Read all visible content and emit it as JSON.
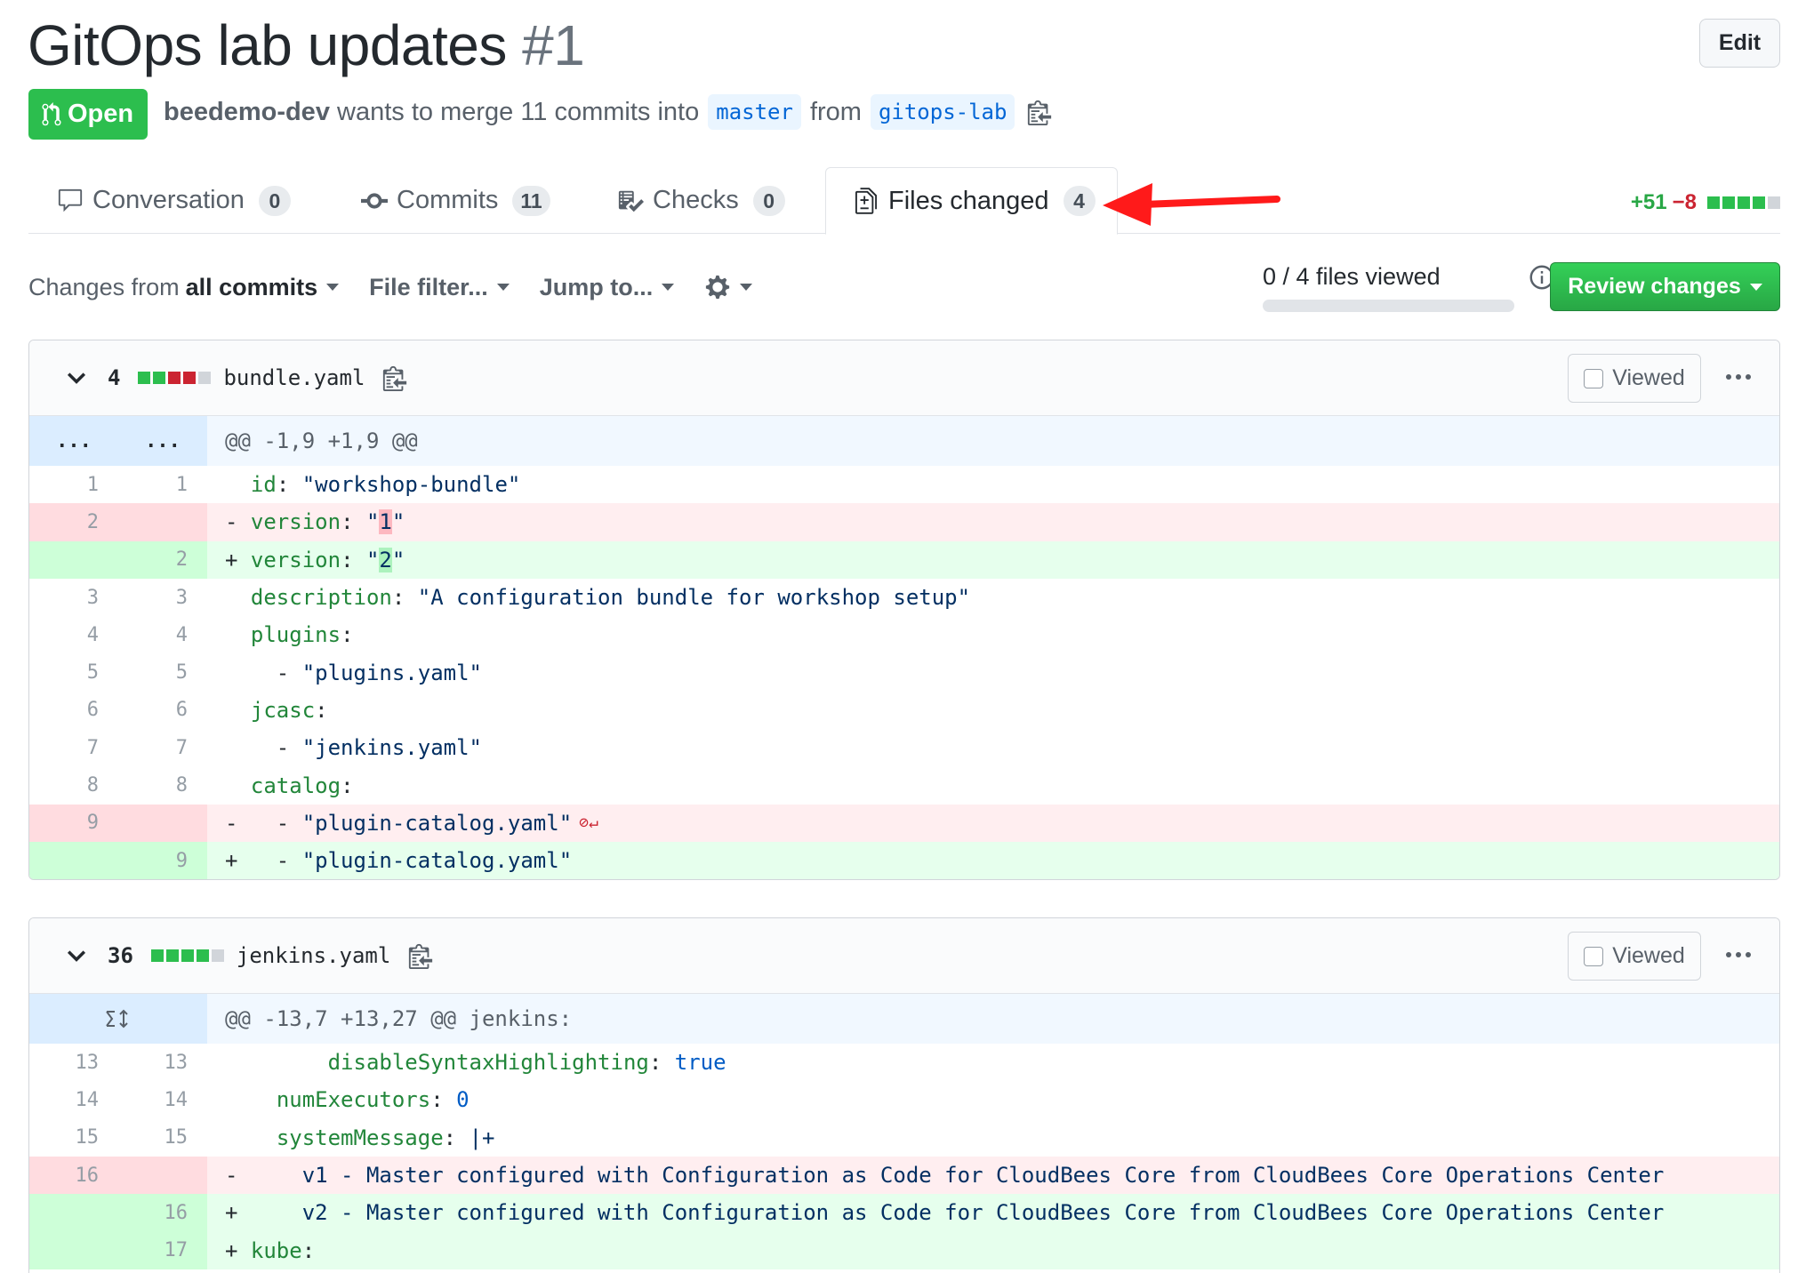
{
  "pr": {
    "title": "GitOps lab updates",
    "number": "#1",
    "edit_label": "Edit",
    "state": "Open",
    "author": "beedemo-dev",
    "merge_text": "wants to merge 11 commits into",
    "base_branch": "master",
    "from_text": "from",
    "head_branch": "gitops-lab"
  },
  "tabs": [
    {
      "label": "Conversation",
      "count": "0",
      "icon": "comment-icon"
    },
    {
      "label": "Commits",
      "count": "11",
      "icon": "commit-icon"
    },
    {
      "label": "Checks",
      "count": "0",
      "icon": "checklist-icon"
    },
    {
      "label": "Files changed",
      "count": "4",
      "icon": "file-diff-icon",
      "selected": true
    }
  ],
  "diffstat": {
    "additions": "+51",
    "deletions": "−8"
  },
  "toolbar": {
    "changes_prefix": "Changes from",
    "changes_value": "all commits",
    "file_filter": "File filter...",
    "jump_to": "Jump to...",
    "files_viewed": "0 / 4 files viewed",
    "review_button": "Review changes"
  },
  "files": [
    {
      "count": "4",
      "name": "bundle.yaml",
      "viewed_label": "Viewed",
      "hunk_left": "...",
      "hunk_right": "...",
      "hunk": "@@ -1,9 +1,9 @@"
    },
    {
      "count": "36",
      "name": "jenkins.yaml",
      "viewed_label": "Viewed",
      "hunk": "@@ -13,7 +13,27 @@ jenkins:"
    }
  ],
  "bundle_lines": [
    {
      "type": "ctx",
      "old": "1",
      "new": "1",
      "sign": " ",
      "indent": "",
      "key": "id",
      "sep": ": ",
      "val": "\"workshop-bundle\""
    },
    {
      "type": "rm",
      "old": "2",
      "new": "",
      "sign": "-",
      "indent": "",
      "key": "version",
      "sep": ": ",
      "val_pre": "\"",
      "val_hl": "1",
      "val_post": "\""
    },
    {
      "type": "ad",
      "old": "",
      "new": "2",
      "sign": "+",
      "indent": "",
      "key": "version",
      "sep": ": ",
      "val_pre": "\"",
      "val_hl": "2",
      "val_post": "\""
    },
    {
      "type": "ctx",
      "old": "3",
      "new": "3",
      "sign": " ",
      "indent": "",
      "key": "description",
      "sep": ": ",
      "val": "\"A configuration bundle for workshop setup\""
    },
    {
      "type": "ctx",
      "old": "4",
      "new": "4",
      "sign": " ",
      "indent": "",
      "key": "plugins",
      "sep": ":",
      "val": ""
    },
    {
      "type": "ctx",
      "old": "5",
      "new": "5",
      "sign": " ",
      "indent": "  - ",
      "key": "",
      "sep": "",
      "val": "\"plugins.yaml\""
    },
    {
      "type": "ctx",
      "old": "6",
      "new": "6",
      "sign": " ",
      "indent": "",
      "key": "jcasc",
      "sep": ":",
      "val": ""
    },
    {
      "type": "ctx",
      "old": "7",
      "new": "7",
      "sign": " ",
      "indent": "  - ",
      "key": "",
      "sep": "",
      "val": "\"jenkins.yaml\""
    },
    {
      "type": "ctx",
      "old": "8",
      "new": "8",
      "sign": " ",
      "indent": "",
      "key": "catalog",
      "sep": ":",
      "val": ""
    },
    {
      "type": "rm",
      "old": "9",
      "new": "",
      "sign": "-",
      "indent": "  - ",
      "key": "",
      "sep": "",
      "val": "\"plugin-catalog.yaml\"",
      "nonl": "⊘↵"
    },
    {
      "type": "ad",
      "old": "",
      "new": "9",
      "sign": "+",
      "indent": "  - ",
      "key": "",
      "sep": "",
      "val": "\"plugin-catalog.yaml\""
    }
  ],
  "jenkins_lines": [
    {
      "type": "ctx",
      "old": "13",
      "new": "13",
      "sign": " ",
      "indent": "      ",
      "key": "disableSyntaxHighlighting",
      "sep": ": ",
      "val": "",
      "const": "true"
    },
    {
      "type": "ctx",
      "old": "14",
      "new": "14",
      "sign": " ",
      "indent": "  ",
      "key": "numExecutors",
      "sep": ": ",
      "val": "",
      "const": "0"
    },
    {
      "type": "ctx",
      "old": "15",
      "new": "15",
      "sign": " ",
      "indent": "  ",
      "key": "systemMessage",
      "sep": ": ",
      "val": "|+"
    },
    {
      "type": "rm",
      "old": "16",
      "new": "",
      "sign": "-",
      "indent": "    ",
      "key": "",
      "sep": "",
      "val": "v1 - Master configured with Configuration as Code for CloudBees Core from CloudBees Core Operations Center"
    },
    {
      "type": "ad",
      "old": "",
      "new": "16",
      "sign": "+",
      "indent": "    ",
      "key": "",
      "sep": "",
      "val": "v2 - Master configured with Configuration as Code for CloudBees Core from CloudBees Core Operations Center"
    },
    {
      "type": "ad",
      "old": "",
      "new": "17",
      "sign": "+",
      "indent": "",
      "key": "kube",
      "sep": ":",
      "val": ""
    }
  ],
  "colors": {
    "open_green": "#2cbe4e",
    "add_bg": "#e6ffed",
    "del_bg": "#ffeef0",
    "hunk_bg": "#f1f8ff",
    "annotation_red": "#ff0000"
  }
}
